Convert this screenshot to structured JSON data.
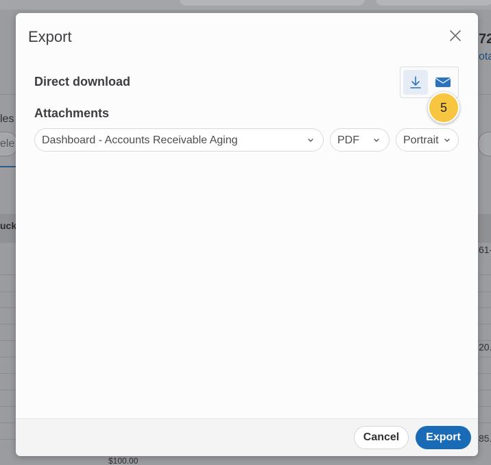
{
  "background": {
    "top_right_number": "72",
    "top_right_link": "ota",
    "left_label_1": "les",
    "left_label_2": "ele",
    "left_label_3": "uck",
    "right_value_1": "61-",
    "right_value_2": "20.",
    "right_value_3": "85.",
    "bottom_value": "$100.00"
  },
  "modal": {
    "title": "Export",
    "direct_download_label": "Direct download",
    "attachments_label": "Attachments",
    "step_number": "5",
    "attachment": {
      "dashboard_value": "Dashboard - Accounts Receivable Aging",
      "format_value": "PDF",
      "orientation_value": "Portrait"
    },
    "footer": {
      "cancel_label": "Cancel",
      "export_label": "Export"
    }
  },
  "colors": {
    "accent": "#1a6bb5",
    "badge": "#f7c53f"
  },
  "icons": {
    "close": "close-icon",
    "download": "download-icon",
    "email": "email-icon",
    "chevron": "chevron-down-icon"
  }
}
